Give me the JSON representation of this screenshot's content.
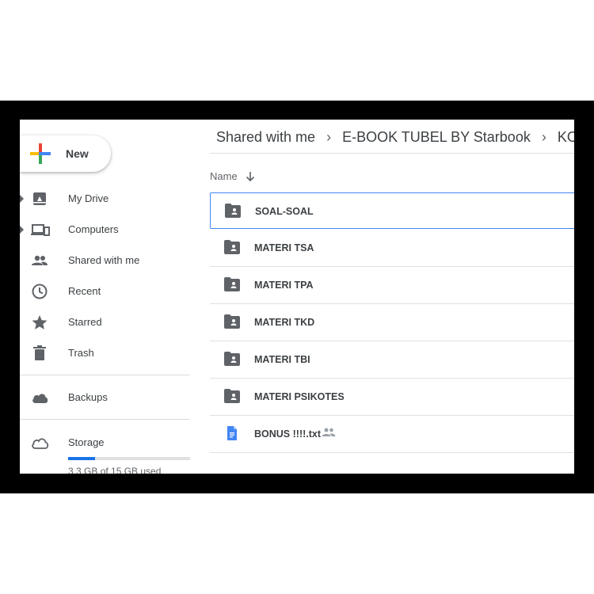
{
  "sidebar": {
    "new_label": "New",
    "items": [
      {
        "label": "My Drive",
        "icon": "my-drive-icon"
      },
      {
        "label": "Computers",
        "icon": "computers-icon"
      },
      {
        "label": "Shared with me",
        "icon": "shared-with-me-icon"
      },
      {
        "label": "Recent",
        "icon": "clock-icon"
      },
      {
        "label": "Starred",
        "icon": "star-icon"
      },
      {
        "label": "Trash",
        "icon": "trash-icon"
      },
      {
        "label": "Backups",
        "icon": "cloud-icon"
      },
      {
        "label": "Storage",
        "icon": "cloud-outline-icon"
      }
    ],
    "storage": {
      "used_text": "3.3 GB of 15 GB used",
      "fraction": 0.22
    }
  },
  "breadcrumb": [
    "Shared with me",
    "E-BOOK TUBEL BY Starbook",
    "KO"
  ],
  "list": {
    "column_name": "Name",
    "rows": [
      {
        "name": "SOAL-SOAL",
        "type": "shared-folder"
      },
      {
        "name": "MATERI TSA",
        "type": "shared-folder"
      },
      {
        "name": "MATERI TPA",
        "type": "shared-folder"
      },
      {
        "name": "MATERI TKD",
        "type": "shared-folder"
      },
      {
        "name": "MATERI TBI",
        "type": "shared-folder"
      },
      {
        "name": "MATERI PSIKOTES",
        "type": "shared-folder"
      },
      {
        "name": "BONUS !!!!.txt",
        "type": "doc"
      }
    ]
  },
  "colors": {
    "accent": "#1a73e8",
    "folder": "#5f6368",
    "selection": "#4285f4"
  }
}
